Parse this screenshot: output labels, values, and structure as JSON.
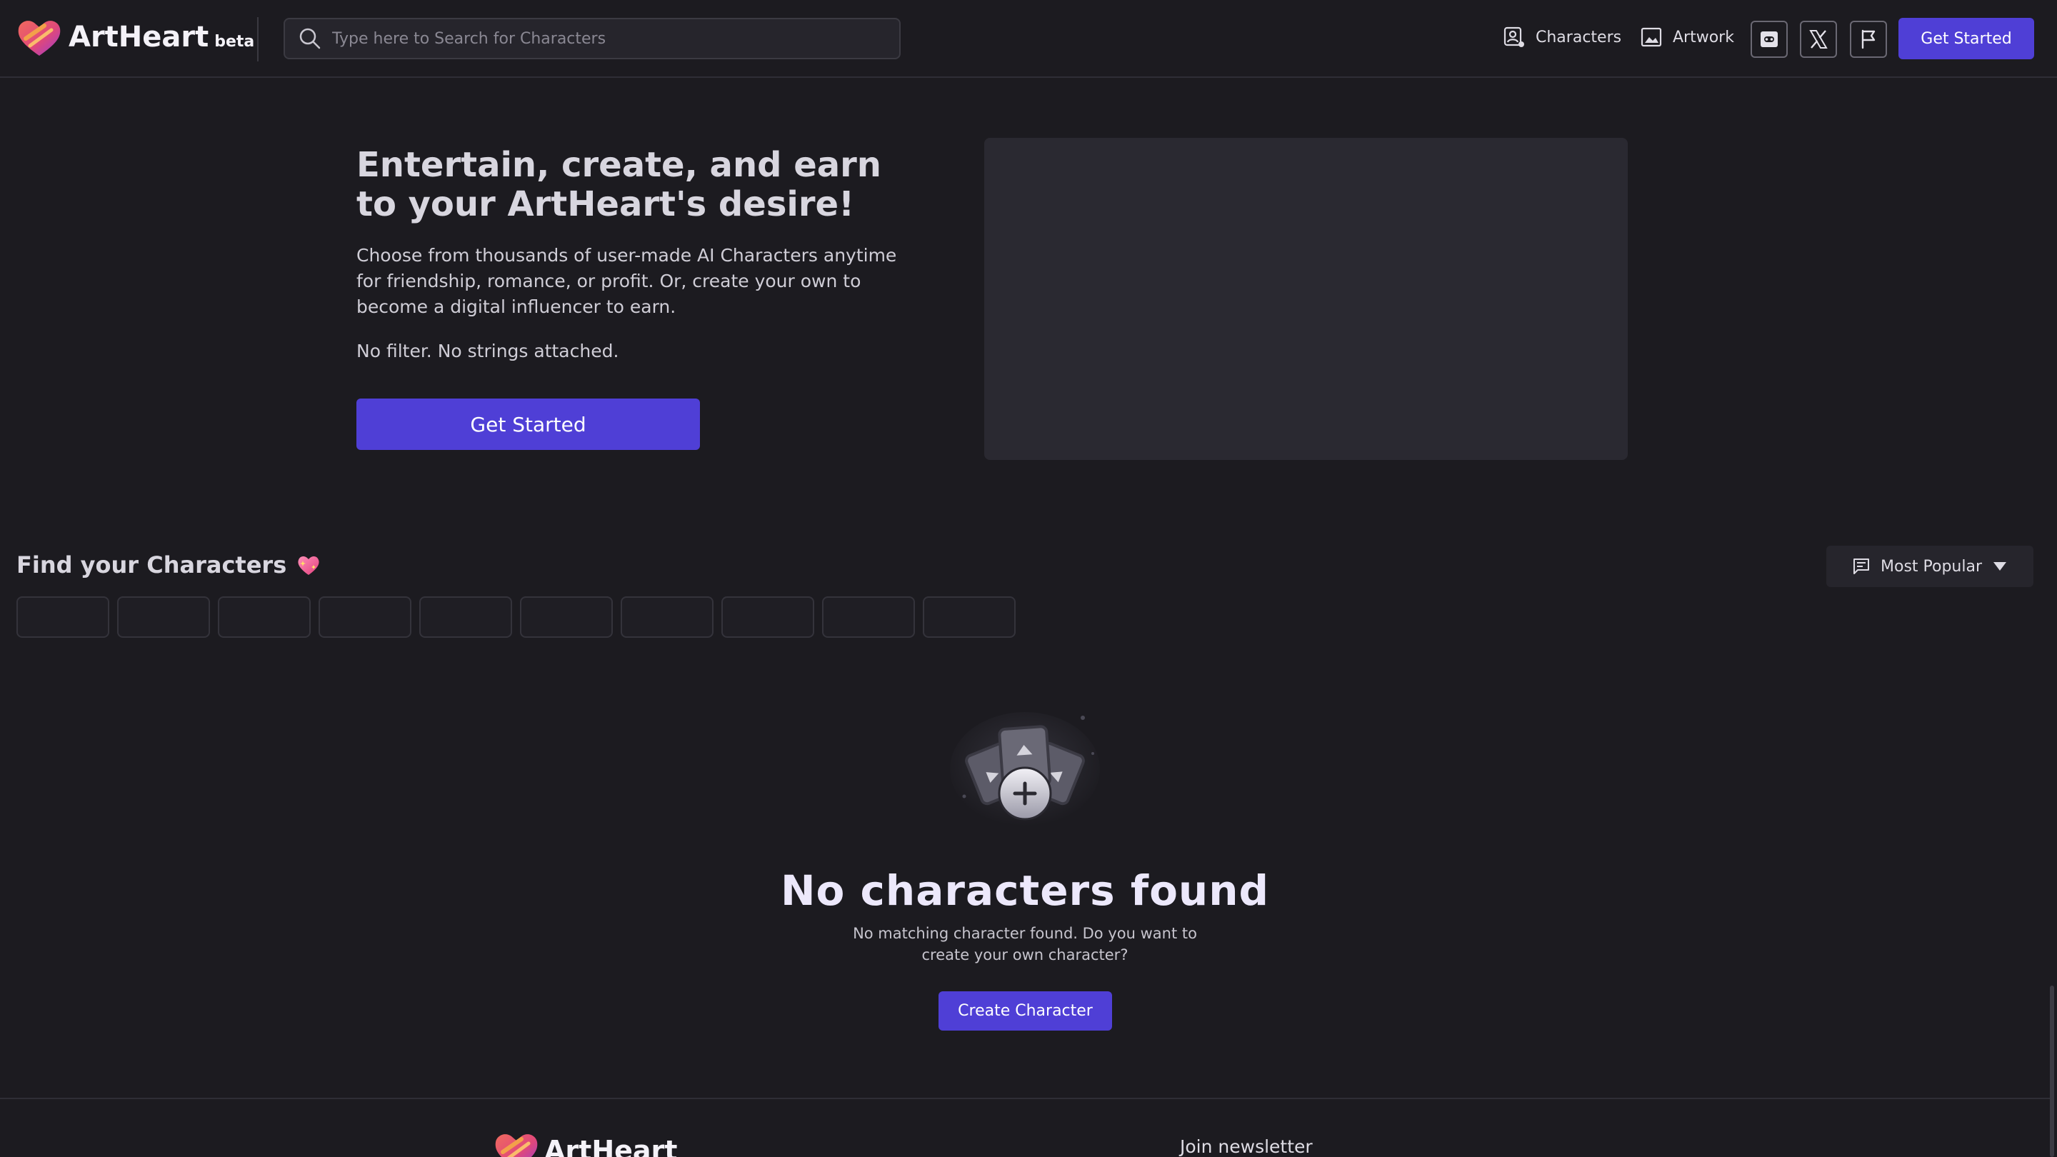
{
  "brand": {
    "name": "ArtHeart",
    "badge": "beta"
  },
  "search": {
    "placeholder": "Type here to Search for Characters"
  },
  "nav": {
    "characters": {
      "label": "Characters",
      "icon": "user-card-icon"
    },
    "artwork": {
      "label": "Artwork",
      "icon": "image-icon"
    }
  },
  "header": {
    "icon_buttons": [
      "discord-icon",
      "x-icon",
      "flag-icon"
    ],
    "cta_label": "Get Started"
  },
  "hero": {
    "title": "Entertain, create, and earn to your ArtHeart's desire!",
    "description": "Choose from thousands of user-made AI Characters anytime for friendship, romance, or profit. Or, create your own to become a digital influencer to earn.",
    "tagline": "No filter. No strings attached.",
    "cta_label": "Get Started"
  },
  "find": {
    "title": "Find your Characters",
    "title_icon": "sparkling-heart-icon",
    "sort": {
      "selected": "Most Popular",
      "icon": "message-square-icon"
    },
    "chip_count_placeholder": 10
  },
  "empty_state": {
    "title": "No characters found",
    "description": "No matching character found. Do you want to create your own character?",
    "cta_label": "Create Character"
  },
  "footer": {
    "brand_name": "ArtHeart",
    "newsletter_label": "Join newsletter"
  },
  "colors": {
    "background": "#1c1b20",
    "accent": "#4f3fd6",
    "surface": "#26252c"
  }
}
